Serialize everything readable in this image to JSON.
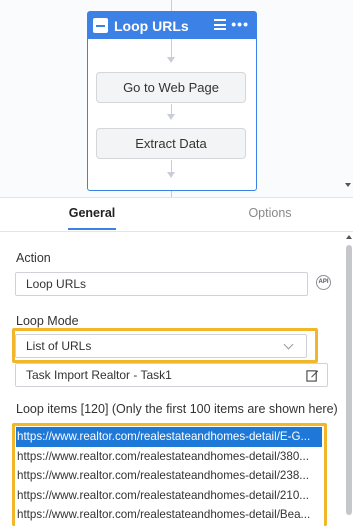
{
  "flow": {
    "loop": {
      "title": "Loop URLs"
    },
    "steps": [
      {
        "label": "Go to Web Page"
      },
      {
        "label": "Extract Data"
      }
    ]
  },
  "tabs": [
    {
      "label": "General",
      "active": true
    },
    {
      "label": "Options",
      "active": false
    }
  ],
  "settings": {
    "action_label": "Action",
    "action_value": "Loop URLs",
    "api_badge": "API",
    "loop_mode_label": "Loop Mode",
    "loop_mode_value": "List of URLs",
    "task_value": "Task Import Realtor - Task1",
    "loop_items_label": "Loop items [120] (Only the first 100 items are shown here)",
    "loop_items": [
      {
        "text": "https://www.realtor.com/realestateandhomes-detail/E-G...",
        "selected": true
      },
      {
        "text": "https://www.realtor.com/realestateandhomes-detail/380...",
        "selected": false
      },
      {
        "text": "https://www.realtor.com/realestateandhomes-detail/238...",
        "selected": false
      },
      {
        "text": "https://www.realtor.com/realestateandhomes-detail/210...",
        "selected": false
      },
      {
        "text": "https://www.realtor.com/realestateandhomes-detail/Bea...",
        "selected": false
      }
    ]
  },
  "colors": {
    "accent": "#3c82e6",
    "highlight": "#f1b62a",
    "selection": "#1e78d7"
  }
}
